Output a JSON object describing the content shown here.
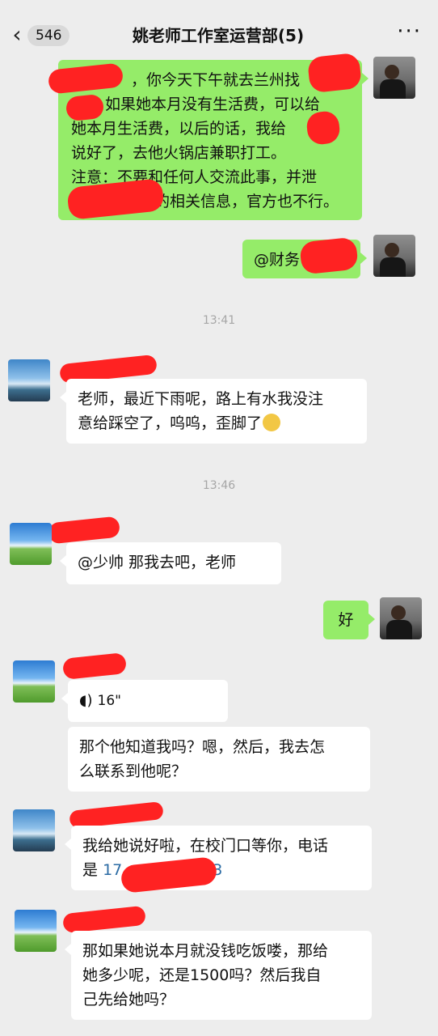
{
  "header": {
    "back_icon": "chevron-left-icon",
    "unread_count": "546",
    "title": "姚老师工作室运营部(5)",
    "more_icon": "more-dots-icon"
  },
  "messages": [
    {
      "id": "m1",
      "side": "right",
      "text_lines": [
        "，你今天下午就去兰州找",
        "如果她本月没有生活费，可以给",
        "她本月生活费，以后的话，我给",
        "说好了，去他火锅店兼职打工。",
        "注意：不要和任何人交流此事，并泄",
        "露的相关信息，官方也不行。"
      ]
    },
    {
      "id": "m2",
      "side": "right",
      "text": "@财务"
    },
    {
      "id": "t1",
      "type": "time",
      "text": "13:41"
    },
    {
      "id": "m3",
      "side": "left",
      "text_line1": "老师，最近下雨呢，路上有水我没注",
      "text_line2": "意给踩空了，呜呜，歪脚了"
    },
    {
      "id": "t2",
      "type": "time",
      "text": "13:46"
    },
    {
      "id": "m4",
      "side": "left",
      "text": "@少帅  那我去吧，老师"
    },
    {
      "id": "m5",
      "side": "right",
      "text": "好"
    },
    {
      "id": "m6",
      "side": "left",
      "type": "voice",
      "duration": "16\""
    },
    {
      "id": "m7",
      "side": "left",
      "text_line1": "那个他知道我吗？嗯，然后，我去怎",
      "text_line2": "么联系到他呢？"
    },
    {
      "id": "m8",
      "side": "left",
      "text_line1": "我给她说好啦，在校门口等你，电话",
      "text_line2_prefix": "是",
      "phone_visible": "17",
      "phone_tail": "3"
    },
    {
      "id": "m9",
      "side": "left",
      "text_line1": "那如果她说本月就没钱吃饭喽，那给",
      "text_line2": "她多少呢，还是1500吗？然后我自",
      "text_line3": "己先给她吗？"
    }
  ]
}
